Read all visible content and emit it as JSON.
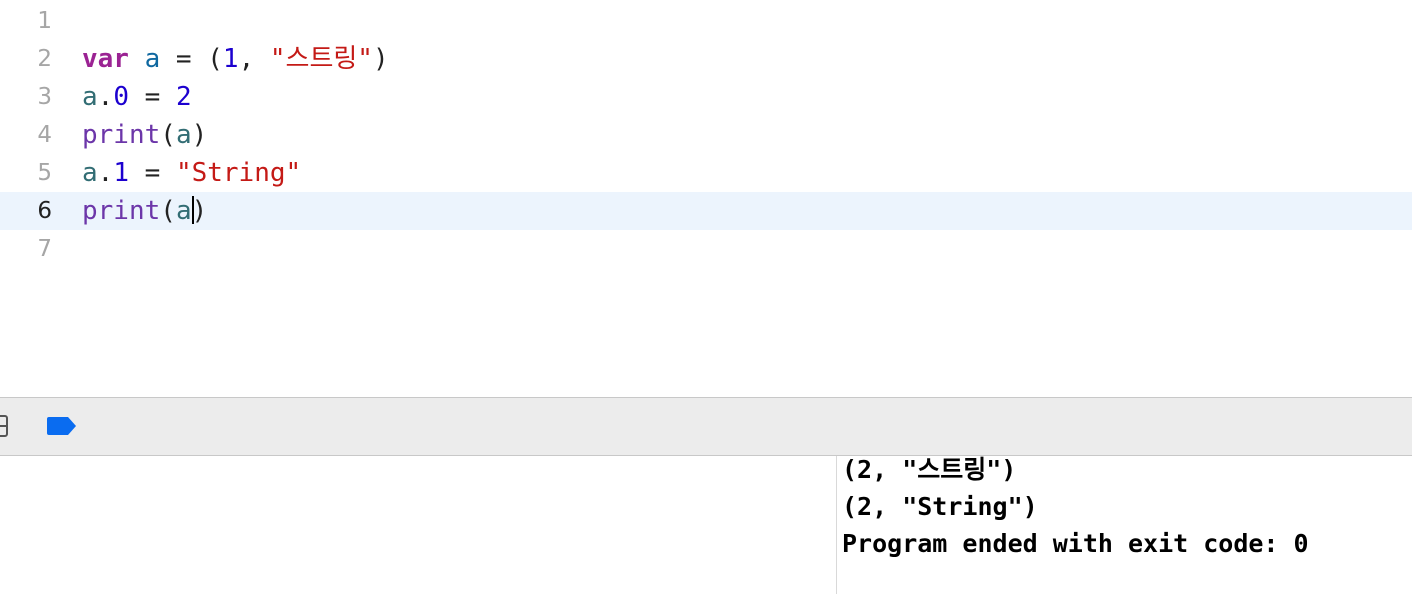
{
  "editor": {
    "lines": [
      {
        "number": "1",
        "tokens": []
      },
      {
        "number": "2",
        "tokens": [
          {
            "type": "keyword",
            "text": "var"
          },
          {
            "type": "plain",
            "text": " "
          },
          {
            "type": "decl",
            "text": "a"
          },
          {
            "type": "plain",
            "text": " = ("
          },
          {
            "type": "number",
            "text": "1"
          },
          {
            "type": "plain",
            "text": ", "
          },
          {
            "type": "string",
            "text": "\"스트링\""
          },
          {
            "type": "plain",
            "text": ")"
          }
        ]
      },
      {
        "number": "3",
        "tokens": [
          {
            "type": "ident",
            "text": "a"
          },
          {
            "type": "plain",
            "text": "."
          },
          {
            "type": "number",
            "text": "0"
          },
          {
            "type": "plain",
            "text": " = "
          },
          {
            "type": "number",
            "text": "2"
          }
        ]
      },
      {
        "number": "4",
        "tokens": [
          {
            "type": "func",
            "text": "print"
          },
          {
            "type": "plain",
            "text": "("
          },
          {
            "type": "ident",
            "text": "a"
          },
          {
            "type": "plain",
            "text": ")"
          }
        ]
      },
      {
        "number": "5",
        "tokens": [
          {
            "type": "ident",
            "text": "a"
          },
          {
            "type": "plain",
            "text": "."
          },
          {
            "type": "number",
            "text": "1"
          },
          {
            "type": "plain",
            "text": " = "
          },
          {
            "type": "string",
            "text": "\"String\""
          }
        ]
      },
      {
        "number": "6",
        "current": true,
        "tokens": [
          {
            "type": "func",
            "text": "print"
          },
          {
            "type": "plain",
            "text": "("
          },
          {
            "type": "ident",
            "text": "a"
          },
          {
            "type": "caret",
            "text": ""
          },
          {
            "type": "plain",
            "text": ")"
          }
        ]
      },
      {
        "number": "7",
        "tokens": []
      }
    ]
  },
  "debug_bar": {
    "panel_toggle_icon": "sidebar-toggle-icon",
    "breakpoint_icon": "breakpoint-icon",
    "breakpoint_color": "#0a6cf0"
  },
  "console": {
    "output": [
      "(2, \"스트링\")",
      "(2, \"String\")",
      "Program ended with exit code: 0"
    ]
  },
  "colors": {
    "current_line_highlight": "#ecf4fd",
    "keyword": "#9b2393",
    "string": "#c41a16",
    "number": "#1c00cf",
    "function": "#6c36a9",
    "identifier": "#326d74"
  }
}
